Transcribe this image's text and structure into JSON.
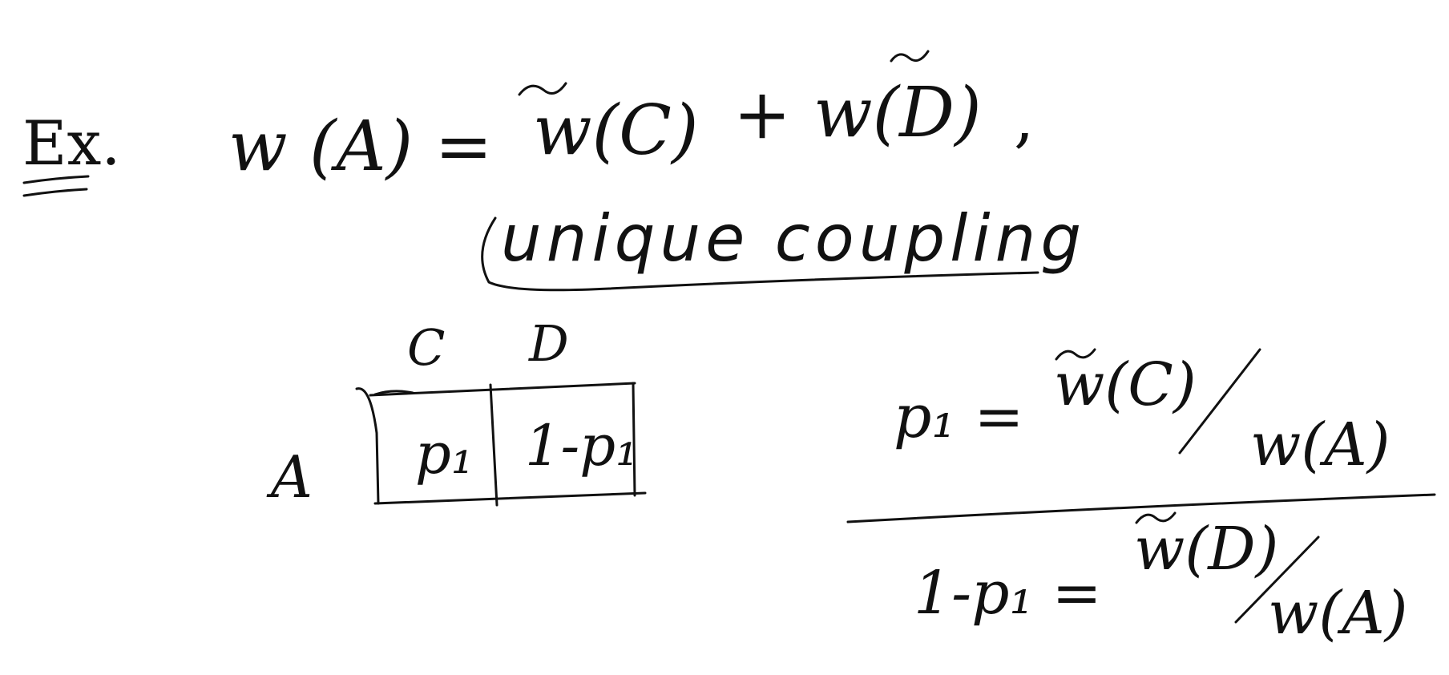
{
  "example": {
    "label": "Ex.",
    "lhs": "w (A) =",
    "term1": "w(C)",
    "plus": "+",
    "term2": "w(D)",
    "comma": ","
  },
  "coupling": {
    "text": "unique coupling"
  },
  "table": {
    "col_headers": [
      "C",
      "D"
    ],
    "row_header": "A",
    "cells": [
      "p₁",
      "1-p₁"
    ]
  },
  "equations": {
    "top_lhs": "p₁ =",
    "top_num": "w(C)",
    "top_den": "w(A)",
    "bottom_lhs": "1-p₁ =",
    "bottom_num": "w(D)",
    "bottom_den": "w(A)"
  },
  "colors": {
    "ink": "#111111",
    "background": "#ffffff"
  }
}
